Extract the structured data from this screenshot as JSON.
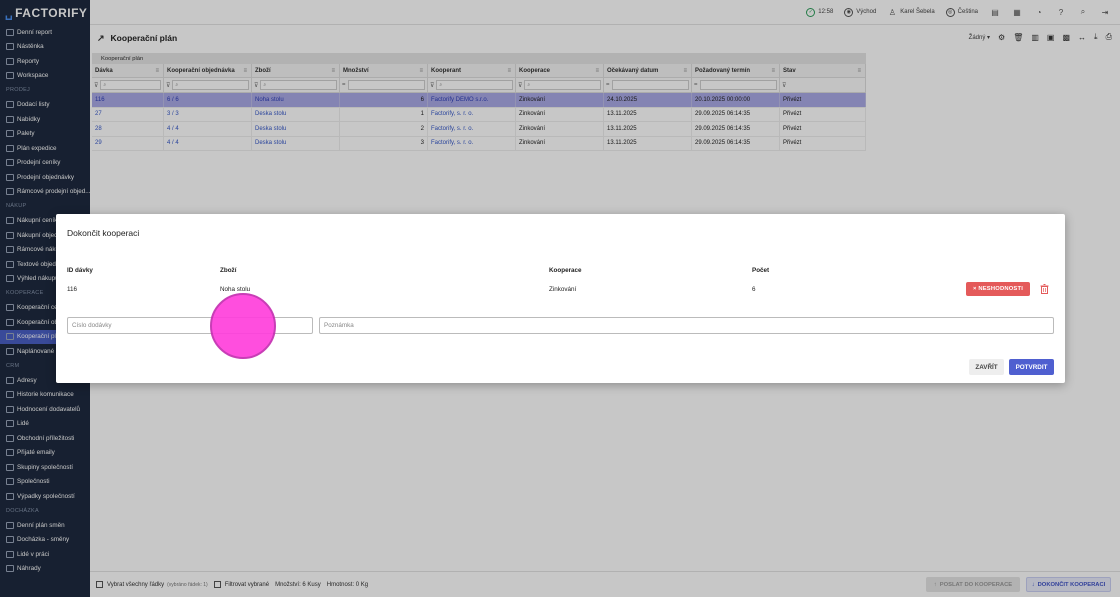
{
  "app": {
    "logo": "FACTORIFY"
  },
  "sidebar": {
    "items": [
      {
        "type": "item",
        "label": "Denní report"
      },
      {
        "type": "item",
        "label": "Nástěnka"
      },
      {
        "type": "item",
        "label": "Reporty"
      },
      {
        "type": "item",
        "label": "Workspace"
      },
      {
        "type": "section",
        "label": "PRODEJ"
      },
      {
        "type": "item",
        "label": "Dodací listy"
      },
      {
        "type": "item",
        "label": "Nabídky"
      },
      {
        "type": "item",
        "label": "Palety"
      },
      {
        "type": "item",
        "label": "Plán expedice"
      },
      {
        "type": "item",
        "label": "Prodejní ceníky"
      },
      {
        "type": "item",
        "label": "Prodejní objednávky"
      },
      {
        "type": "item",
        "label": "Rámcové prodejní objed..."
      },
      {
        "type": "section",
        "label": "NÁKUP"
      },
      {
        "type": "item",
        "label": "Nákupní ceníky"
      },
      {
        "type": "item",
        "label": "Nákupní objednávky"
      },
      {
        "type": "item",
        "label": "Rámcové nákupní"
      },
      {
        "type": "item",
        "label": "Textové objednávky"
      },
      {
        "type": "item",
        "label": "Výhled nákupů"
      },
      {
        "type": "section",
        "label": "KOOPERACE"
      },
      {
        "type": "item",
        "label": "Kooperační ceníky"
      },
      {
        "type": "item",
        "label": "Kooperační objednávky"
      },
      {
        "type": "item",
        "label": "Kooperační plán",
        "active": true
      },
      {
        "type": "item",
        "label": "Naplánované kooperace"
      },
      {
        "type": "section",
        "label": "CRM"
      },
      {
        "type": "item",
        "label": "Adresy"
      },
      {
        "type": "item",
        "label": "Historie komunikace"
      },
      {
        "type": "item",
        "label": "Hodnocení dodavatelů"
      },
      {
        "type": "item",
        "label": "Lidé"
      },
      {
        "type": "item",
        "label": "Obchodní příležitosti"
      },
      {
        "type": "item",
        "label": "Přijaté emaily"
      },
      {
        "type": "item",
        "label": "Skupiny společností"
      },
      {
        "type": "item",
        "label": "Společnosti"
      },
      {
        "type": "item",
        "label": "Výpadky společností"
      },
      {
        "type": "section",
        "label": "DOCHÁZKA"
      },
      {
        "type": "item",
        "label": "Denní plán směn"
      },
      {
        "type": "item",
        "label": "Docházka - směny"
      },
      {
        "type": "item",
        "label": "Lidé v práci"
      },
      {
        "type": "item",
        "label": "Náhrady"
      }
    ]
  },
  "topbar": {
    "time": "12:58",
    "exit_label": "Východ",
    "user": "Karel Šebela",
    "language": "Čeština"
  },
  "page": {
    "title": "Kooperační plán",
    "view_select": "Žádný"
  },
  "grid": {
    "title": "Kooperační plán",
    "columns": [
      "Dávka",
      "Kooperační objednávka",
      "Zboží",
      "Množství",
      "Kooperant",
      "Kooperace",
      "Očekávaný datum",
      "Požadovaný termín",
      "Stav"
    ],
    "rows": [
      {
        "cells": [
          "116",
          "6 / 6",
          "Noha stolu",
          "6",
          "Factorify DEMO s.r.o.",
          "Zinkování",
          "24.10.2025",
          "20.10.2025 00:00:00",
          "Přivézt"
        ],
        "selected": true
      },
      {
        "cells": [
          "27",
          "3 / 3",
          "Deska stolu",
          "1",
          "Factorify, s. r. o.",
          "Zinkování",
          "13.11.2025",
          "29.09.2025 06:14:35",
          "Přivézt"
        ]
      },
      {
        "cells": [
          "28",
          "4 / 4",
          "Deska stolu",
          "2",
          "Factorify, s. r. o.",
          "Zinkování",
          "13.11.2025",
          "29.09.2025 06:14:35",
          "Přivézt"
        ]
      },
      {
        "cells": [
          "29",
          "4 / 4",
          "Deska stolu",
          "3",
          "Factorify, s. r. o.",
          "Zinkování",
          "13.11.2025",
          "29.09.2025 06:14:35",
          "Přivézt"
        ]
      }
    ]
  },
  "dialog": {
    "title": "Dokončit kooperaci",
    "headers": {
      "batch": "ID dávky",
      "goods": "Zboží",
      "coop": "Kooperace",
      "count": "Počet"
    },
    "row": {
      "batch": "116",
      "goods": "Noha stolu",
      "coop": "Zinkování",
      "count": "6"
    },
    "nonconformity_label": "× NESHODNOSTI",
    "delivery_placeholder": "Číslo dodávky",
    "note_placeholder": "Poznámka",
    "close_label": "ZAVŘÍT",
    "confirm_label": "POTVRDIT"
  },
  "footer": {
    "select_all": "Vybrat všechny řádky",
    "selected_info": "(vybráno řádek: 1)",
    "filter_selected": "Filtrovat vybrané",
    "quantity": "Množství: 6 Kusy",
    "weight": "Hmotnost: 0 Kg",
    "send_label": "POSLAT DO KOOPERACE",
    "finish_label": "DOKONČIT KOOPERACI"
  }
}
